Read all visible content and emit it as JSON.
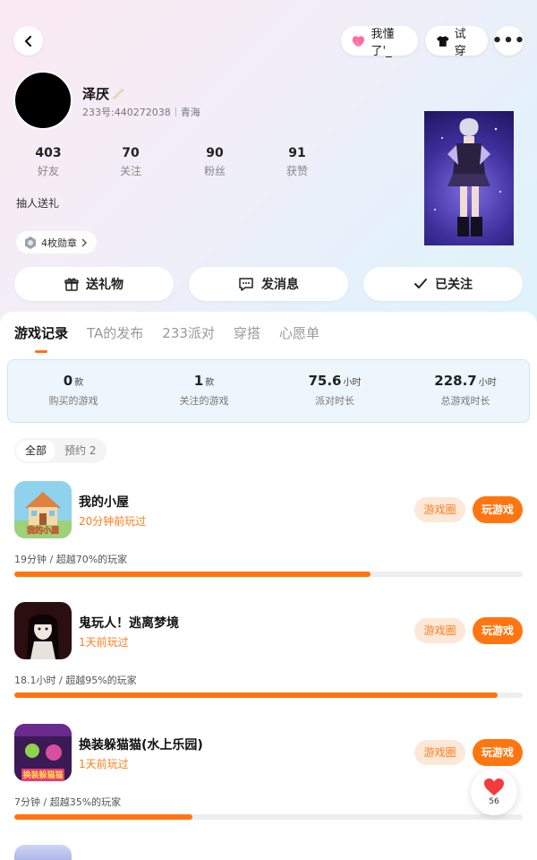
{
  "header": {
    "like_label": "我懂了'_",
    "try_label": "试穿"
  },
  "profile": {
    "name": "泽厌",
    "account": "233号:440272038",
    "region": "青海",
    "bio": "抽人送礼",
    "badge_label": "4枚勋章",
    "stats": [
      {
        "value": "403",
        "label": "好友"
      },
      {
        "value": "70",
        "label": "关注"
      },
      {
        "value": "90",
        "label": "粉丝"
      },
      {
        "value": "91",
        "label": "获赞"
      }
    ]
  },
  "actions": {
    "gift": "送礼物",
    "message": "发消息",
    "follow": "已关注"
  },
  "tabs": [
    "游戏记录",
    "TA的发布",
    "233派对",
    "穿搭",
    "心愿单"
  ],
  "summary": [
    {
      "value": "0",
      "unit": "款",
      "label": "购买的游戏"
    },
    {
      "value": "1",
      "unit": "款",
      "label": "关注的游戏"
    },
    {
      "value": "75.6",
      "unit": "小时",
      "label": "派对时长"
    },
    {
      "value": "228.7",
      "unit": "小时",
      "label": "总游戏时长"
    }
  ],
  "filters": [
    "全部",
    "预约 2"
  ],
  "games": [
    {
      "name": "我的小屋",
      "played": "20分钟前玩过",
      "stat": "19分钟 / 超越70%的玩家",
      "percent": 70,
      "circle_label": "游戏圈",
      "play_label": "玩游戏"
    },
    {
      "name": "鬼玩人！逃离梦境",
      "played": "1天前玩过",
      "stat": "18.1小时 / 超越95%的玩家",
      "percent": 95,
      "circle_label": "游戏圈",
      "play_label": "玩游戏"
    },
    {
      "name": "换装躲猫猫(水上乐园)",
      "played": "1天前玩过",
      "stat": "7分钟 / 超越35%的玩家",
      "percent": 35,
      "circle_label": "游戏圈",
      "play_label": "玩游戏"
    }
  ],
  "icon_texts": {
    "game1": "我的小屋",
    "game3": "换装躲猫猫"
  },
  "fab_count": "56",
  "colors": {
    "accent": "#ff7510",
    "accent_soft": "#fde8d8",
    "summary_bg": "#edf6fd"
  }
}
